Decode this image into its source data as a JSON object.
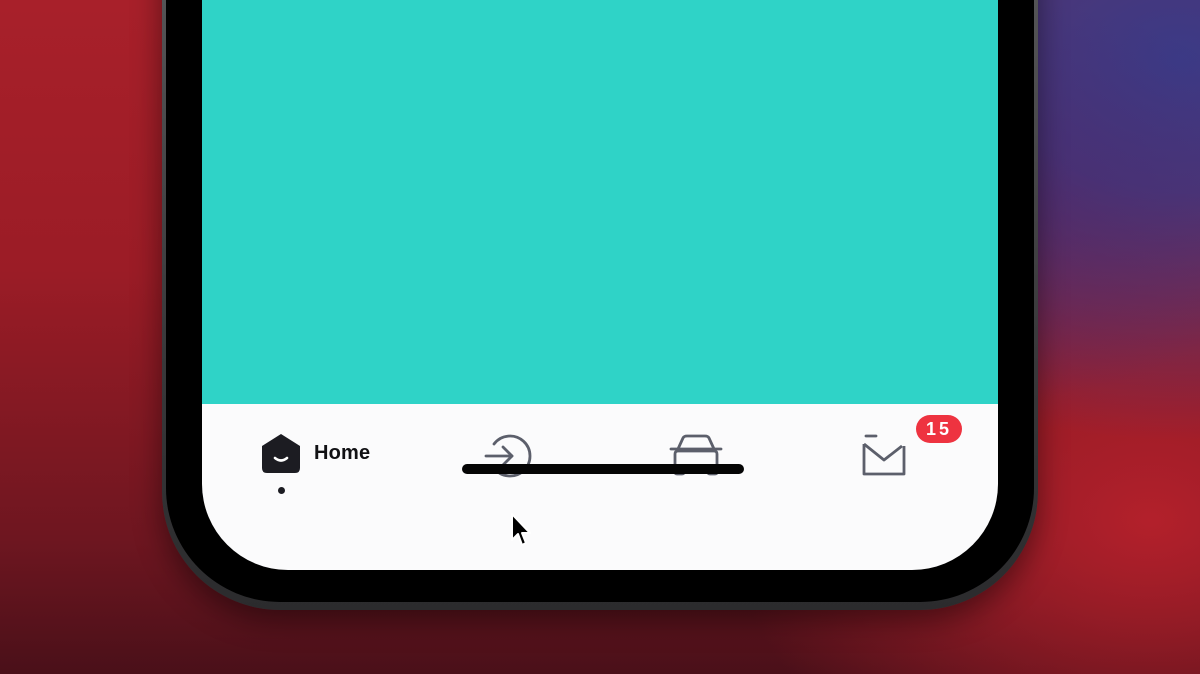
{
  "screen": {
    "content_color": "#2fd3c7",
    "tab_bar_color": "#fbfbfc"
  },
  "tab_bar": {
    "tabs": [
      {
        "id": "home",
        "label": "Home",
        "icon": "home-icon",
        "active": true
      },
      {
        "id": "checkin",
        "label": "",
        "icon": "arrow-circle-icon",
        "active": false
      },
      {
        "id": "car",
        "label": "",
        "icon": "car-icon",
        "active": false
      },
      {
        "id": "messages",
        "label": "",
        "icon": "mail-icon",
        "active": false,
        "badge": "15"
      }
    ],
    "active_color": "#1c1c22",
    "inactive_color": "#5c5f6b",
    "badge_color": "#ee3340"
  },
  "system": {
    "home_indicator": "home-indicator",
    "pointer": "mouse-cursor-icon"
  }
}
